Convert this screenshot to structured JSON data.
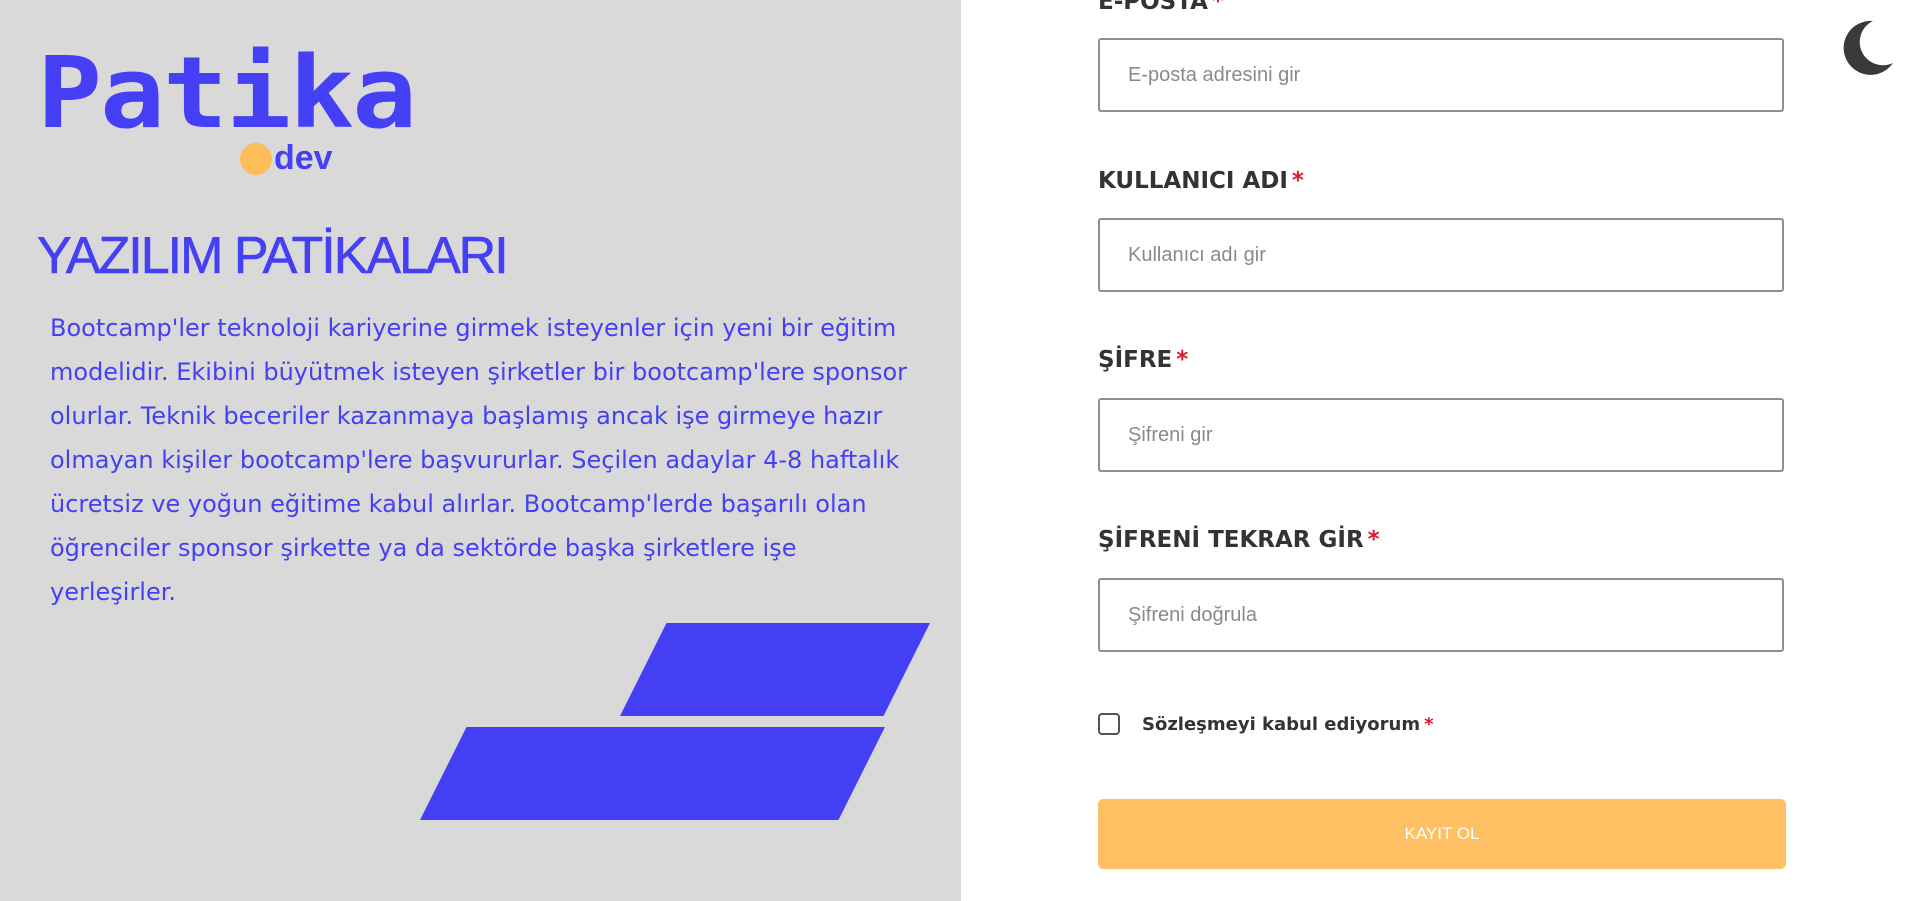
{
  "brand": {
    "logo_word": "Patika",
    "logo_suffix": "dev",
    "primary_color": "#4540f5",
    "accent_color": "#ffbd59"
  },
  "left_panel": {
    "title": "YAZILIM PATİKALARI",
    "description": "Bootcamp'ler teknoloji kariyerine girmek isteyenler için yeni bir eğitim modelidir. Ekibini büyütmek isteyen şirketler bir bootcamp'lere sponsor olurlar. Teknik beceriler kazanmaya başlamış ancak işe girmeye hazır olmayan kişiler bootcamp'lere başvururlar. Seçilen adaylar 4-8 haftalık ücretsiz ve yoğun eğitime kabul alırlar. Bootcamp'lerde başarılı olan öğrenciler sponsor şirkette ya da sektörde başka şirketlere işe yerleşirler.",
    "background_color": "#d9d9d9"
  },
  "form": {
    "email": {
      "label": "E-POSTA",
      "required_mark": "*",
      "placeholder": "E-posta adresini gir",
      "value": ""
    },
    "username": {
      "label": "KULLANICI ADI",
      "required_mark": "*",
      "placeholder": "Kullanıcı adı gir",
      "value": ""
    },
    "password": {
      "label": "ŞİFRE",
      "required_mark": "*",
      "placeholder": "Şifreni gir",
      "value": ""
    },
    "password_confirm": {
      "label": "ŞİFRENİ TEKRAR GİR",
      "required_mark": "*",
      "placeholder": "Şifreni doğrula",
      "value": ""
    },
    "agreement": {
      "label": "Sözleşmeyi kabul ediyorum",
      "required_mark": "*",
      "checked": false
    },
    "submit_label": "KAYIT OL",
    "submit_color": "#ffbf63",
    "required_color": "#e0162b"
  },
  "theme_toggle": {
    "icon": "moon-icon",
    "color": "#3a3a3a"
  }
}
